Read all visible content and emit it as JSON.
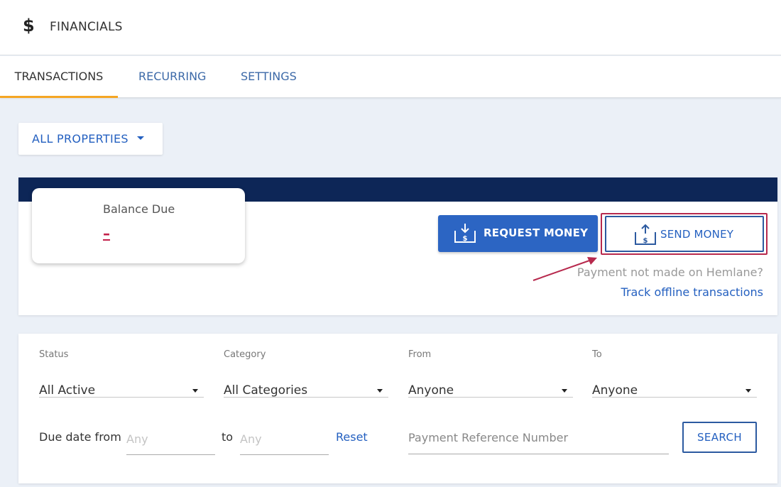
{
  "header": {
    "icon": "dollar-icon",
    "dollar_glyph": "$",
    "title": "FINANCIALS"
  },
  "tabs": [
    {
      "label": "TRANSACTIONS",
      "active": true
    },
    {
      "label": "RECURRING",
      "active": false
    },
    {
      "label": "SETTINGS",
      "active": false
    }
  ],
  "property_filter": {
    "label": "ALL PROPERTIES"
  },
  "balance": {
    "label": "Balance Due",
    "value": "–"
  },
  "actions": {
    "request_label": "REQUEST MONEY",
    "send_label": "SEND MONEY",
    "offline_text": "Payment not made on Hemlane?",
    "offline_link": "Track offline transactions"
  },
  "filters": {
    "status": {
      "label": "Status",
      "value": "All Active"
    },
    "category": {
      "label": "Category",
      "value": "All Categories"
    },
    "from": {
      "label": "From",
      "value": "Anyone"
    },
    "to": {
      "label": "To",
      "value": "Anyone"
    }
  },
  "due_date": {
    "label": "Due date from",
    "from_placeholder": "Any",
    "to_label": "to",
    "to_placeholder": "Any",
    "reset_label": "Reset"
  },
  "reference": {
    "placeholder": "Payment Reference Number"
  },
  "search_label": "SEARCH",
  "colors": {
    "accent": "#2c65c3",
    "navy": "#0d2657",
    "highlight": "#b7294d",
    "tab_underline": "#f5a623"
  }
}
